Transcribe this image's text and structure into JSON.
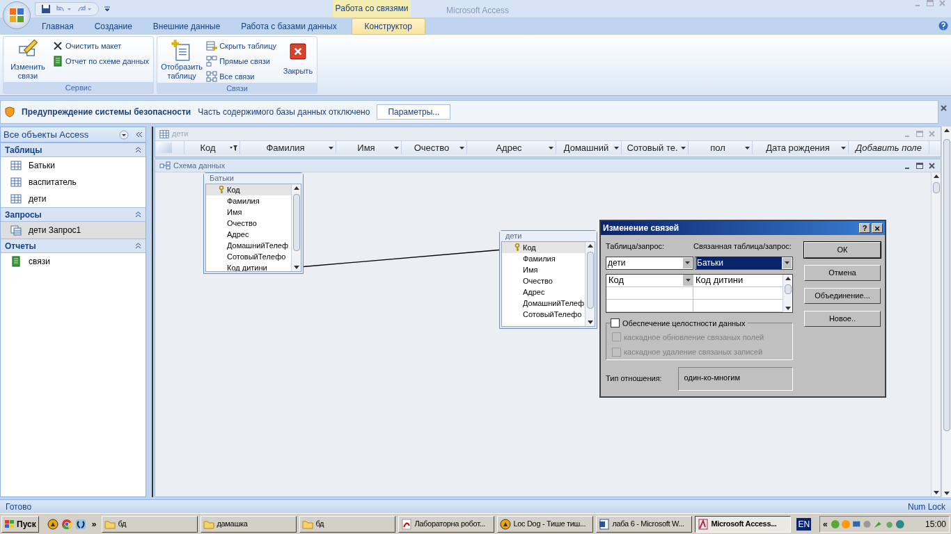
{
  "title_bar": {
    "contextual_tab": "Работа со связями",
    "title": "Microsoft Access"
  },
  "ribbon_tabs": [
    {
      "label": "Главная",
      "selected": false
    },
    {
      "label": "Создание",
      "selected": false
    },
    {
      "label": "Внешние данные",
      "selected": false
    },
    {
      "label": "Работа с базами данных",
      "selected": false
    },
    {
      "label": "Конструктор",
      "selected": true
    }
  ],
  "ribbon_groups": [
    {
      "title": "Сервис",
      "large": [
        {
          "label": "Изменить связи",
          "kind": "edit"
        }
      ],
      "small": [
        {
          "label": "Очистить макет",
          "kind": "clear"
        },
        {
          "label": "Отчет по схеме данных",
          "kind": "report"
        }
      ]
    },
    {
      "title": "Связи",
      "large": [
        {
          "label": "Отобразить таблицу",
          "kind": "show"
        }
      ],
      "small": [
        {
          "label": "Скрыть таблицу",
          "kind": "hide"
        },
        {
          "label": "Прямые связи",
          "kind": "direct"
        },
        {
          "label": "Все связи",
          "kind": "all"
        }
      ],
      "after": [
        {
          "label": "Закрыть",
          "kind": "close"
        }
      ]
    }
  ],
  "security_bar": {
    "title": "Предупреждение системы безопасности",
    "message": "Часть содержимого базы данных отключено",
    "button": "Параметры..."
  },
  "nav": {
    "title": "Все объекты Access",
    "groups": [
      {
        "title": "Таблицы",
        "items": [
          {
            "label": "Батьки",
            "kind": "table",
            "selected": false
          },
          {
            "label": "васпитатель",
            "kind": "table",
            "selected": false
          },
          {
            "label": "дети",
            "kind": "table",
            "selected": false
          }
        ]
      },
      {
        "title": "Запросы",
        "items": [
          {
            "label": "дети Запрос1",
            "kind": "query",
            "selected": true
          }
        ]
      },
      {
        "title": "Отчеты",
        "items": [
          {
            "label": "связи",
            "kind": "report",
            "selected": false
          }
        ]
      }
    ]
  },
  "datasheet": {
    "title": "дети",
    "columns": [
      {
        "label": "Код",
        "kind": "filtered"
      },
      {
        "label": "Фамилия",
        "kind": "normal"
      },
      {
        "label": "Имя",
        "kind": "normal"
      },
      {
        "label": "Очество",
        "kind": "normal"
      },
      {
        "label": "Адрес",
        "kind": "normal"
      },
      {
        "label": "Домашний",
        "kind": "normal"
      },
      {
        "label": "Сотовый те.",
        "kind": "normal"
      },
      {
        "label": "пол",
        "kind": "normal"
      },
      {
        "label": "Дата рождения",
        "kind": "normal"
      },
      {
        "label": "Добавить поле",
        "kind": "add"
      }
    ]
  },
  "schema": {
    "title": "Схема данных",
    "tables": [
      {
        "title": "Батьки",
        "fields": [
          {
            "name": "Код",
            "key": true,
            "selected": true
          },
          {
            "name": "Фамилия",
            "key": false,
            "selected": false
          },
          {
            "name": "Имя",
            "key": false,
            "selected": false
          },
          {
            "name": "Очество",
            "key": false,
            "selected": false
          },
          {
            "name": "Адрес",
            "key": false,
            "selected": false
          },
          {
            "name": "ДомашнийТелеф",
            "key": false,
            "selected": false
          },
          {
            "name": "СотовыйТелефо",
            "key": false,
            "selected": false
          },
          {
            "name": "Код дитини",
            "key": false,
            "selected": false
          }
        ]
      },
      {
        "title": "дети",
        "fields": [
          {
            "name": "Код",
            "key": true,
            "selected": true
          },
          {
            "name": "Фамилия",
            "key": false,
            "selected": false
          },
          {
            "name": "Имя",
            "key": false,
            "selected": false
          },
          {
            "name": "Очество",
            "key": false,
            "selected": false
          },
          {
            "name": "Адрес",
            "key": false,
            "selected": false
          },
          {
            "name": "ДомашнийТелеф",
            "key": false,
            "selected": false
          },
          {
            "name": "СотовыйТелефо",
            "key": false,
            "selected": false
          }
        ]
      }
    ]
  },
  "dialog": {
    "title": "Изменение связей",
    "help": "?",
    "close": "×",
    "table_label": "Таблица/запрос:",
    "table_value": "дети",
    "related_label": "Связанная таблица/запрос:",
    "related_value": "Батьки",
    "field_rows": [
      {
        "left": "Код",
        "right": "Код дитини"
      }
    ],
    "integrity": {
      "label": "Обеспечение целостности данных",
      "checked": false
    },
    "cascade": [
      {
        "label": "каскадное обновление связаных полей",
        "checked": false,
        "disabled": true
      },
      {
        "label": "каскадное удаление связаных записей",
        "checked": false,
        "disabled": true
      }
    ],
    "relation_label": "Тип отношения:",
    "relation_value": "один-ко-многим",
    "buttons": [
      "ОК",
      "Отмена",
      "Объединение...",
      "Новое.."
    ]
  },
  "status_bar": {
    "left": "Готово",
    "right": "Num Lock"
  },
  "taskbar": {
    "start": "Пуск",
    "more": "»",
    "tasks": [
      {
        "label": "бд",
        "kind": "folder",
        "selected": false
      },
      {
        "label": "дамашка",
        "kind": "folder",
        "selected": false
      },
      {
        "label": "бд",
        "kind": "folder",
        "selected": false
      },
      {
        "label": "Лабораторна робот...",
        "kind": "pdf",
        "selected": false
      },
      {
        "label": "Loc Dog - Тише тиш...",
        "kind": "player",
        "selected": false
      },
      {
        "label": "лаба 6 - Microsoft W...",
        "kind": "word",
        "selected": false
      },
      {
        "label": "Microsoft Access...",
        "kind": "access",
        "selected": true
      }
    ],
    "tray_more": "«",
    "lang": "EN",
    "time": "15:00"
  }
}
